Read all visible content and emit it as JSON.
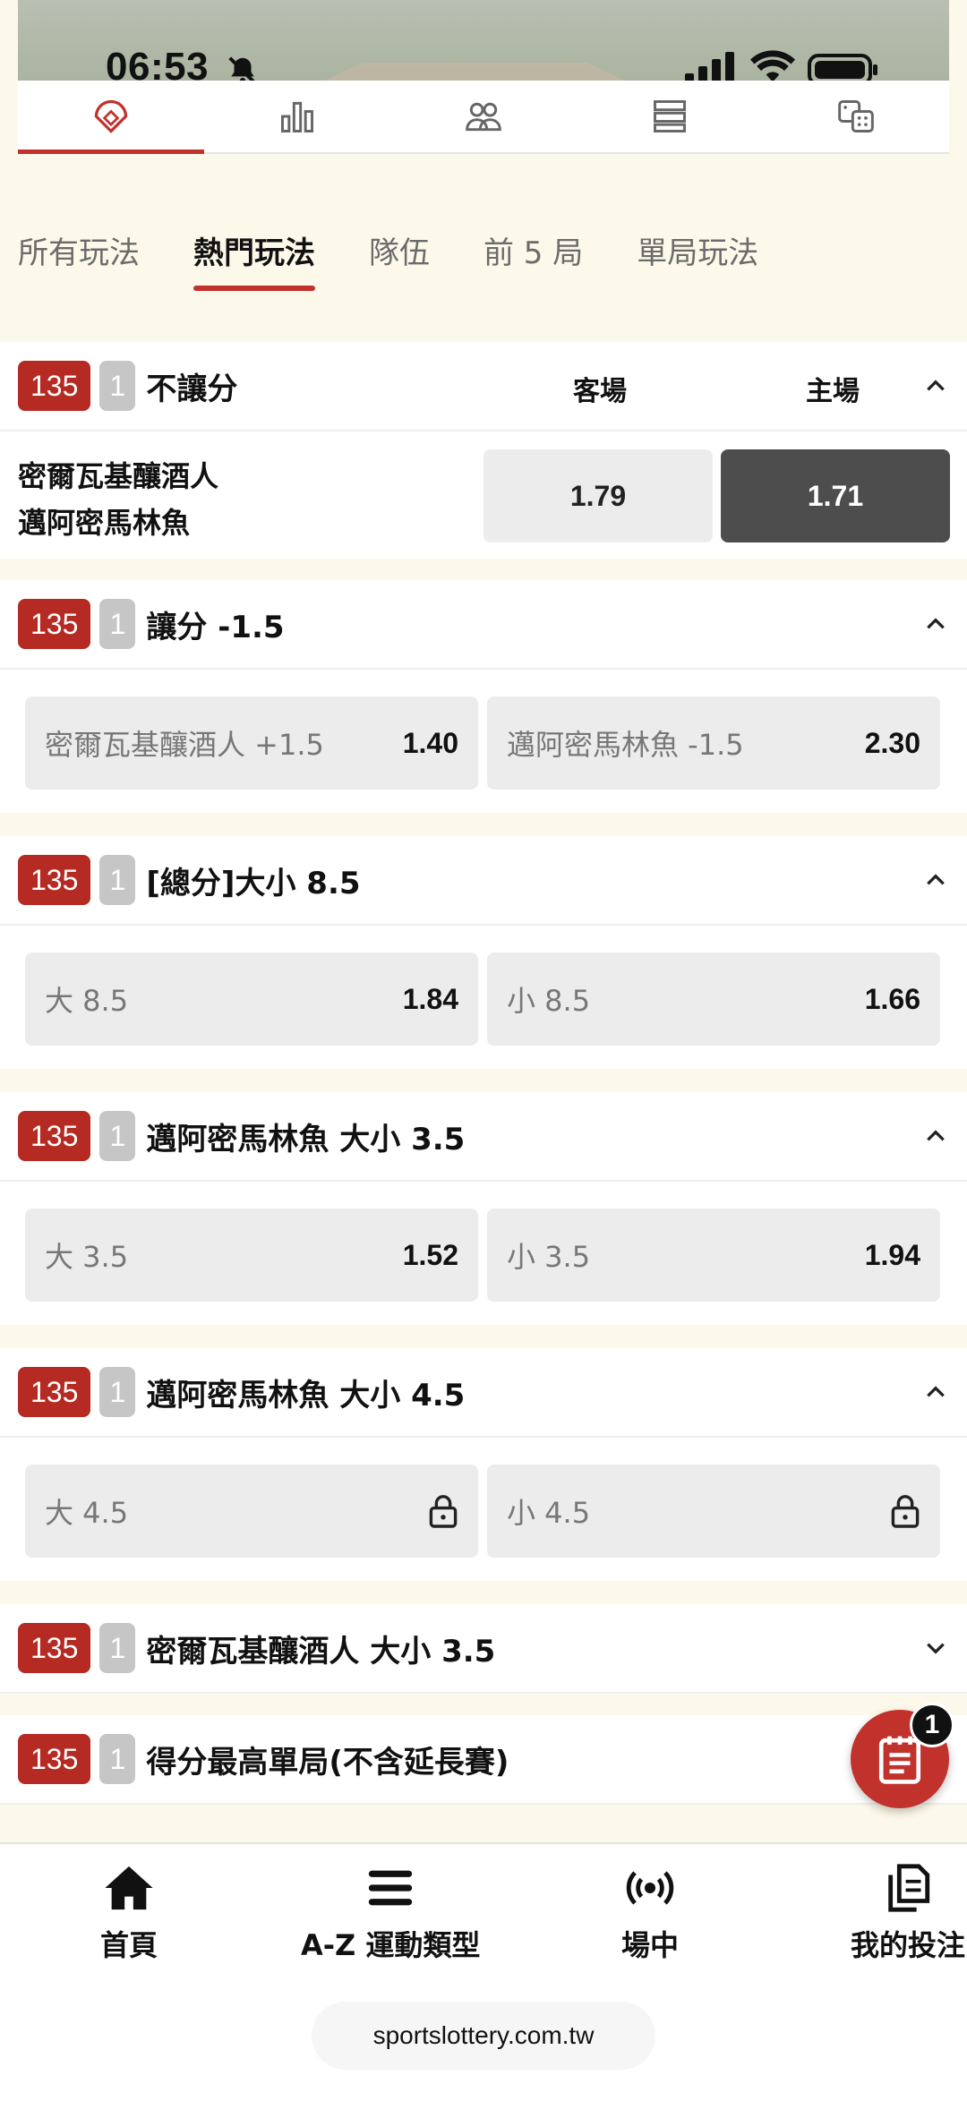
{
  "status": {
    "time": "06:53"
  },
  "top_tabs": [
    "baseball-field-icon",
    "stats-bars-icon",
    "players-icon",
    "list-rows-icon",
    "dice-icon"
  ],
  "filter_tabs": [
    {
      "label": "所有玩法",
      "active": false
    },
    {
      "label": "熱門玩法",
      "active": true
    },
    {
      "label": "隊伍",
      "active": false
    },
    {
      "label": "前 5 局",
      "active": false
    },
    {
      "label": "單局玩法",
      "active": false
    }
  ],
  "markets": {
    "moneyline": {
      "code": "135",
      "period": "1",
      "title": "不讓分",
      "col_away": "客場",
      "col_home": "主場",
      "team_away": "密爾瓦基釀酒人",
      "team_home": "邁阿密馬林魚",
      "odd_away": "1.79",
      "odd_home": "1.71"
    },
    "spread": {
      "code": "135",
      "period": "1",
      "title": "讓分 -1.5",
      "left_label": "密爾瓦基釀酒人 +1.5",
      "left_odd": "1.40",
      "right_label": "邁阿密馬林魚 -1.5",
      "right_odd": "2.30"
    },
    "total": {
      "code": "135",
      "period": "1",
      "title": "[總分]大小 8.5",
      "left_label": "大 8.5",
      "left_odd": "1.84",
      "right_label": "小 8.5",
      "right_odd": "1.66"
    },
    "team_total_35": {
      "code": "135",
      "period": "1",
      "title": "邁阿密馬林魚 大小 3.5",
      "left_label": "大 3.5",
      "left_odd": "1.52",
      "right_label": "小 3.5",
      "right_odd": "1.94"
    },
    "team_total_45": {
      "code": "135",
      "period": "1",
      "title": "邁阿密馬林魚 大小 4.5",
      "left_label": "大 4.5",
      "right_label": "小 4.5"
    },
    "brewers_total": {
      "code": "135",
      "period": "1",
      "title": "密爾瓦基釀酒人 大小 3.5"
    },
    "highest_inning": {
      "code": "135",
      "period": "1",
      "title": "得分最高單局(不含延長賽)"
    }
  },
  "bet_slip": {
    "count": "1"
  },
  "bottom_nav": {
    "home": "首頁",
    "az": "A-Z 運動類型",
    "live": "場中",
    "my_bets": "我的投注"
  },
  "url": "sportslottery.com.tw",
  "colors": {
    "accent": "#c2322c",
    "badge": "#b52a22",
    "background": "#fdf9ea"
  }
}
